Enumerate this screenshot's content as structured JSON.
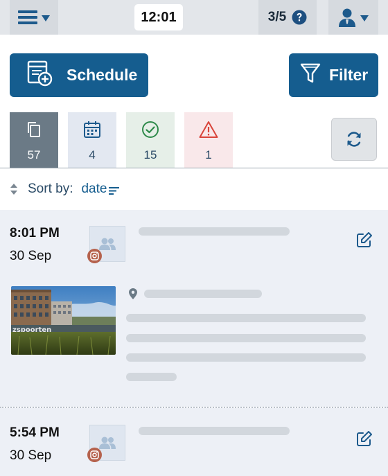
{
  "topbar": {
    "time": "12:01",
    "count": "3/5",
    "menu_icon": "hamburger-menu-icon",
    "user_icon": "user-icon",
    "help_icon": "help-question-icon"
  },
  "actions": {
    "schedule_label": "Schedule",
    "filter_label": "Filter"
  },
  "tabs": [
    {
      "icon": "copy-icon",
      "count": "57"
    },
    {
      "icon": "calendar-icon",
      "count": "4"
    },
    {
      "icon": "check-circle-icon",
      "count": "15"
    },
    {
      "icon": "warning-icon",
      "count": "1"
    }
  ],
  "sort": {
    "label": "Sort by:",
    "value": "date"
  },
  "posts": [
    {
      "time": "8:01 PM",
      "date": "30 Sep",
      "network": "instagram"
    },
    {
      "time": "5:54 PM",
      "date": "30 Sep",
      "network": "instagram"
    }
  ],
  "colors": {
    "primary": "#155d8f",
    "instagram_badge": "#b5624d",
    "warning": "#d9443a",
    "success": "#2e8a4a"
  }
}
